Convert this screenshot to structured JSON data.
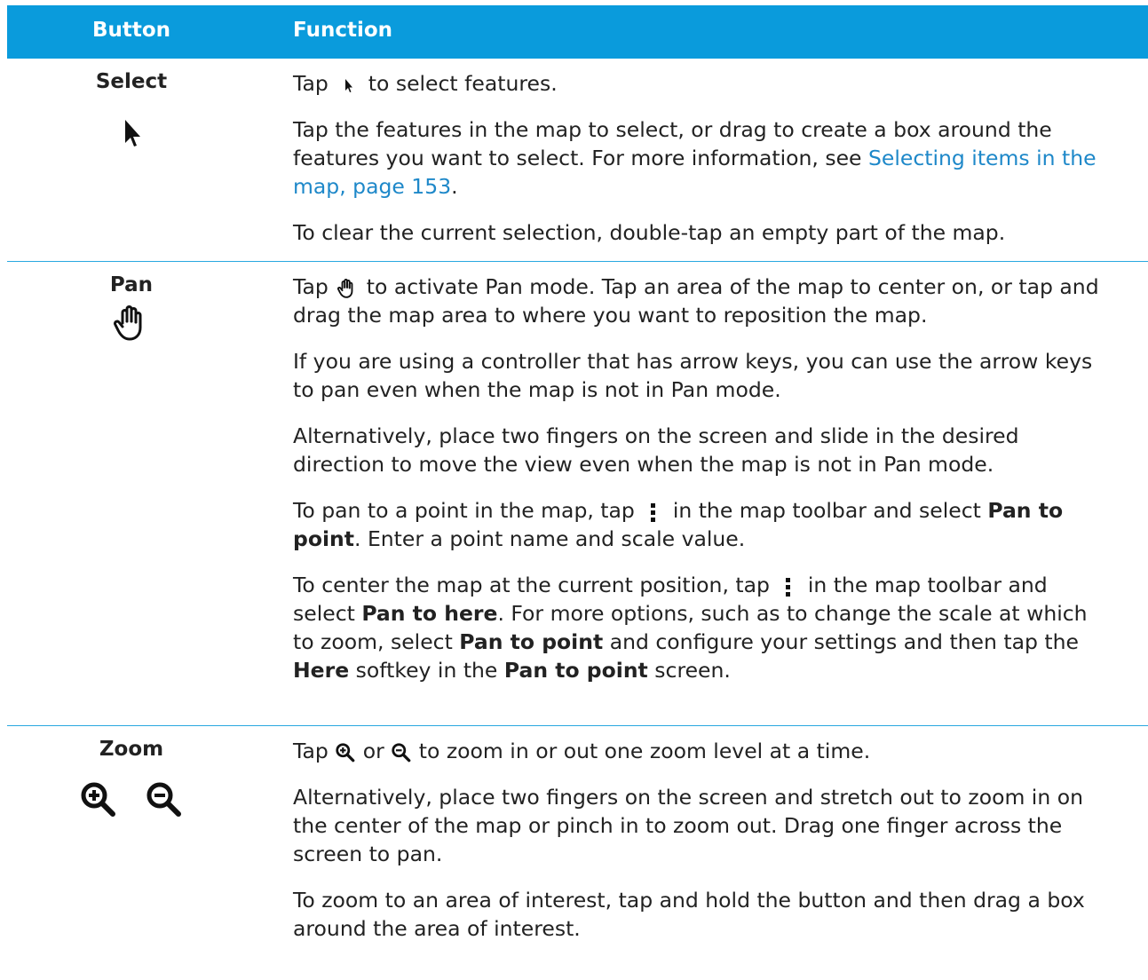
{
  "header": {
    "col1": "Button",
    "col2": "Function"
  },
  "select": {
    "name": "Select",
    "p1a": "Tap",
    "p1b": "to select features.",
    "p2a": "Tap the features in the map to select, or drag to create a box around the features you want to select. For more information, see",
    "p2link": "Selecting items in the map, page 153",
    "p2end": ".",
    "p3": "To clear the current selection, double-tap an empty part of the map."
  },
  "pan": {
    "name": "Pan",
    "p1a": "Tap",
    "p1b": "to activate Pan mode. Tap an area of the map to center on, or tap and drag the map area to where you want to reposition the map.",
    "p2": "If you are using a controller that has arrow keys, you can use the arrow keys to pan even when the map is not in Pan mode.",
    "p3": "Alternatively, place two fingers on the screen and slide in the desired direction to move the view even when the map is not in Pan mode.",
    "p4a": "To pan to a point in the map, tap",
    "p4b": "in the map toolbar and select",
    "p4bold": "Pan to point",
    "p4c": ". Enter a point name and scale value.",
    "p5a": "To center the map at the current position, tap",
    "p5b": "in the map toolbar and select",
    "p5bold1": "Pan to here",
    "p5c": ". For more options, such as to change the scale at which to zoom, select",
    "p5bold2": "Pan to point",
    "p5d": "and configure your settings and then tap the",
    "p5bold3": "Here",
    "p5e": "softkey in the",
    "p5bold4": "Pan to point",
    "p5f": "screen."
  },
  "zoom": {
    "name": "Zoom",
    "p1a": "Tap",
    "p1or": "or",
    "p1b": "to zoom in or out one zoom level at a time.",
    "p2": "Alternatively, place two fingers on the screen and stretch out to zoom in on the center of the map or pinch in to zoom out. Drag one finger across the screen to pan.",
    "p3": "To zoom to an area of interest, tap and hold the button and then drag a box around the area of interest."
  }
}
